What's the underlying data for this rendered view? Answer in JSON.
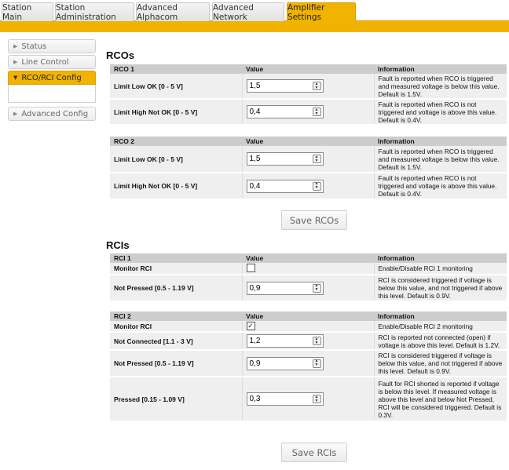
{
  "tabs": [
    {
      "label": "Station Main",
      "active": false
    },
    {
      "label": "Station Administration",
      "active": false
    },
    {
      "label": "Advanced Alphacom",
      "active": false
    },
    {
      "label": "Advanced Network",
      "active": false
    },
    {
      "label": "Amplifier Settings",
      "active": true
    }
  ],
  "sidebar": {
    "items": [
      {
        "label": "Status"
      },
      {
        "label": "Line Control"
      },
      {
        "label": "RCO/RCI Config"
      },
      {
        "label": "Advanced Config"
      }
    ]
  },
  "rcos": {
    "title": "RCOs",
    "tables": [
      {
        "name": "RCO 1",
        "value_header": "Value",
        "info_header": "Information",
        "rows": [
          {
            "label": "Limit Low OK [0 - 5 V]",
            "value": "1,5",
            "info": "Fault is reported when RCO is triggered and measured voltage is below this value. Default is 1.5V."
          },
          {
            "label": "Limit High Not OK [0 - 5 V]",
            "value": "0,4",
            "info": "Fault is reported when RCO is not triggered and voltage is above this value. Default is 0.4V."
          }
        ]
      },
      {
        "name": "RCO 2",
        "value_header": "Value",
        "info_header": "Information",
        "rows": [
          {
            "label": "Limit Low OK [0 - 5 V]",
            "value": "1,5",
            "info": "Fault is reported when RCO is triggered and measured voltage is below this value. Default is 1.5V."
          },
          {
            "label": "Limit High Not OK [0 - 5 V]",
            "value": "0,4",
            "info": "Fault is reported when RCO is not triggered and voltage is above this value. Default is 0.4V."
          }
        ]
      }
    ],
    "save_label": "Save RCOs"
  },
  "rcis": {
    "title": "RCIs",
    "tables": [
      {
        "name": "RCI 1",
        "value_header": "Value",
        "info_header": "Information",
        "rows": [
          {
            "label": "Monitor RCI",
            "type": "checkbox",
            "checked": false,
            "info": "Enable/Disable RCI 1 monitoring"
          },
          {
            "label": "Not Pressed [0.5 - 1.19 V]",
            "value": "0,9",
            "info": "RCI is considered triggered if voltage is below this value, and not triggered if above this level. Default is 0.9V."
          }
        ]
      },
      {
        "name": "RCI 2",
        "value_header": "Value",
        "info_header": "Information",
        "rows": [
          {
            "label": "Monitor RCI",
            "type": "checkbox",
            "checked": true,
            "info": "Enable/Disable RCI 2 monitoring"
          },
          {
            "label": "Not Connected [1.1 - 3 V]",
            "value": "1,2",
            "info": "RCI is reported not connected (open) if voltage is above this level. Default is 1.2V."
          },
          {
            "label": "Not Pressed [0.5 - 1.19 V]",
            "value": "0,9",
            "info": "RCI is considered triggered if voltage is below this value, and not triggered if above this level. Default is 0.9V."
          },
          {
            "label": "Pressed [0.15 - 1.09 V]",
            "value": "0,3",
            "info": "Fault for RCI shorted is reported if voltage is below this level. If measured voltage is above this level and below Not Pressed, RCI will be considered triggered. Default is 0.3V."
          }
        ]
      }
    ],
    "save_label": "Save RCIs"
  },
  "colors": {
    "accent": "#f2b300",
    "header_row": "#cdcdcd",
    "row_bg": "#efefef"
  }
}
